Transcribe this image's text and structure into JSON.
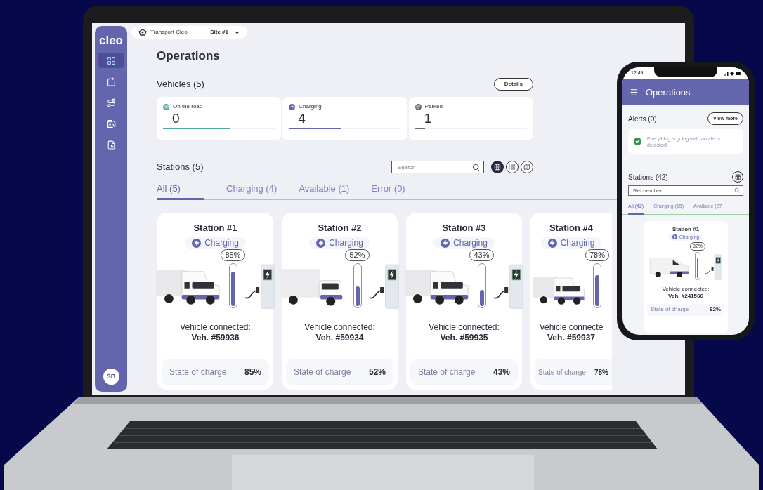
{
  "laptop": {
    "sidebar": {
      "brand": "cleo",
      "nav": [
        {
          "kind": "dashboard",
          "selected": true
        },
        {
          "kind": "calendar",
          "selected": false
        },
        {
          "kind": "routes",
          "selected": false
        },
        {
          "kind": "charger",
          "selected": false
        },
        {
          "kind": "reports",
          "selected": false
        }
      ],
      "avatar": "SB"
    },
    "topbar": {
      "company": "Transport Cleo",
      "site": "Site #1"
    },
    "page_title": "Operations",
    "vehicles": {
      "title": "Vehicles (5)",
      "button": "Details",
      "stats": [
        {
          "kind": "road",
          "label": "On the road",
          "value": "0",
          "level": 0.6,
          "color": "#4ba99f"
        },
        {
          "kind": "charging",
          "label": "Charging",
          "value": "4",
          "level": 0.47,
          "color": "#6366ad"
        },
        {
          "kind": "parked",
          "label": "Parked",
          "value": "1",
          "level": 0.09,
          "color": "#6b6b6b"
        }
      ]
    },
    "stations": {
      "title": "Stations (5)",
      "search": {
        "placeholder": "Search"
      },
      "views": [
        {
          "kind": "grid",
          "selected": true
        },
        {
          "kind": "list",
          "selected": false
        },
        {
          "kind": "map",
          "selected": false
        }
      ],
      "tabs": [
        {
          "label": "All (5)",
          "selected": true
        },
        {
          "label": "Charging (4)",
          "selected": false
        },
        {
          "label": "Available (1)",
          "selected": false
        },
        {
          "label": "Error (0)",
          "selected": false
        }
      ],
      "cards": [
        {
          "name": "Station #1",
          "status": "Charging",
          "kind": "semi",
          "level": 0.85,
          "percent": "85%",
          "connected": "Vehicle connected:",
          "vehicle_id": "Veh. #59936",
          "soc_label": "State of charge",
          "soc_value": "85%"
        },
        {
          "name": "Station #2",
          "status": "Charging",
          "kind": "box",
          "level": 0.52,
          "percent": "52%",
          "connected": "Vehicle connected:",
          "vehicle_id": "Veh. #59934",
          "soc_label": "State of charge",
          "soc_value": "52%"
        },
        {
          "name": "Station #3",
          "status": "Charging",
          "kind": "semi",
          "level": 0.43,
          "percent": "43%",
          "connected": "Vehicle connected:",
          "vehicle_id": "Veh. #59935",
          "soc_label": "State of charge",
          "soc_value": "43%"
        },
        {
          "name": "Station #4",
          "status": "Charging",
          "kind": "semi",
          "level": 0.78,
          "percent": "78%",
          "connected": "Vehicle connecte",
          "vehicle_id": "Veh. #59937",
          "soc_label": "State of charge",
          "soc_value": "78%"
        }
      ]
    }
  },
  "phone": {
    "time": "12:49",
    "title": "Operations",
    "alerts": {
      "title": "Alerts (0)",
      "button": "View more",
      "message": "Everything is going well, no alerts detected!"
    },
    "stations": {
      "title": "Stations (42)",
      "search": {
        "placeholder": "Rechercher"
      },
      "tabs": [
        {
          "label": "All (42)",
          "selected": true
        },
        {
          "label": "Charging (15)",
          "selected": false
        },
        {
          "label": "Available (27",
          "selected": false
        }
      ],
      "card": {
        "name": "Station #1",
        "status": "Charging",
        "kind": "van",
        "level": 0.82,
        "percent": "82%",
        "connected": "Vehicle connected:",
        "vehicle_id": "Veh. #241566",
        "soc_label": "State of charge",
        "soc_value": "82%"
      }
    }
  }
}
